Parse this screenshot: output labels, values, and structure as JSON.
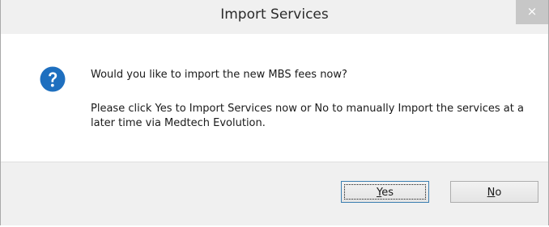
{
  "dialog": {
    "title": "Import Services",
    "close_glyph": "×",
    "icon": "question-icon",
    "message_primary": "Would you like to import the new MBS fees now?",
    "message_secondary": "Please click Yes to Import Services now or No to manually Import the services at a later time via Medtech Evolution.",
    "buttons": {
      "yes": {
        "mnemonic": "Y",
        "rest": "es"
      },
      "no": {
        "mnemonic": "N",
        "rest": "o"
      }
    }
  },
  "colors": {
    "titlebar_bg": "#f0f0f0",
    "icon_blue": "#1e6fbf",
    "close_bg": "#c7c7c7",
    "default_button_border": "#3c7fb1"
  }
}
